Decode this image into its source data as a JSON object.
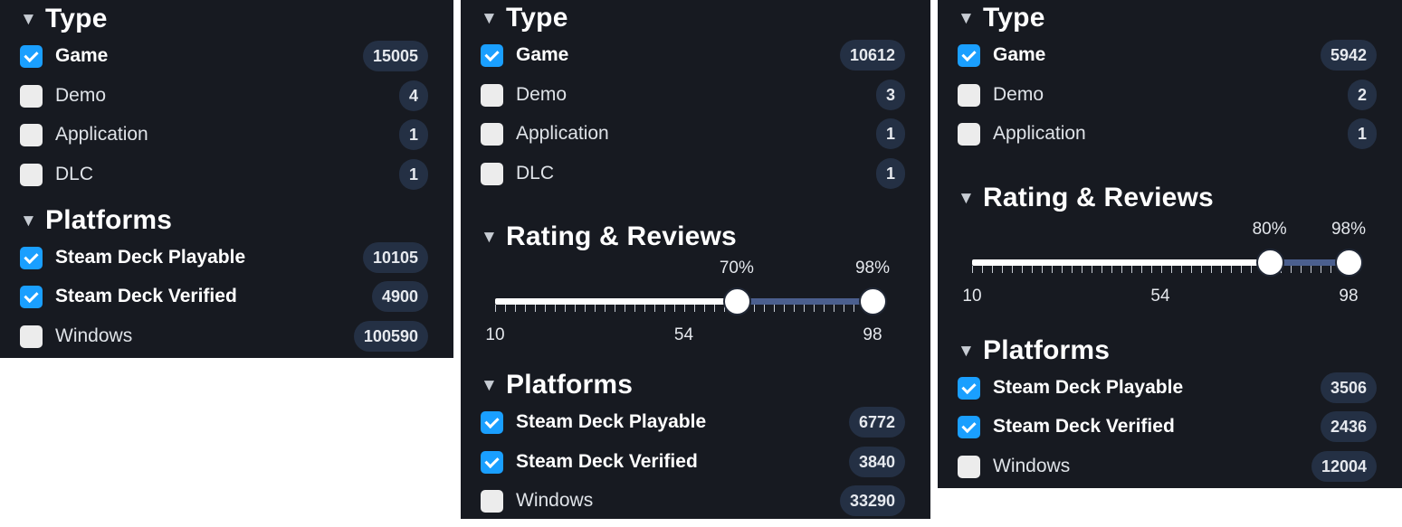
{
  "panels": [
    {
      "type": {
        "title": "Type",
        "items": [
          {
            "label": "Game",
            "count": "15005",
            "checked": true
          },
          {
            "label": "Demo",
            "count": "4",
            "checked": false
          },
          {
            "label": "Application",
            "count": "1",
            "checked": false
          },
          {
            "label": "DLC",
            "count": "1",
            "checked": false
          }
        ]
      },
      "platforms": {
        "title": "Platforms",
        "items": [
          {
            "label": "Steam Deck Playable",
            "count": "10105",
            "checked": true
          },
          {
            "label": "Steam Deck Verified",
            "count": "4900",
            "checked": true
          },
          {
            "label": "Windows",
            "count": "100590",
            "checked": false
          }
        ]
      }
    },
    {
      "type": {
        "title": "Type",
        "items": [
          {
            "label": "Game",
            "count": "10612",
            "checked": true
          },
          {
            "label": "Demo",
            "count": "3",
            "checked": false
          },
          {
            "label": "Application",
            "count": "1",
            "checked": false
          },
          {
            "label": "DLC",
            "count": "1",
            "checked": false
          }
        ]
      },
      "rating": {
        "title": "Rating & Reviews",
        "low_label": "70%",
        "high_label": "98%",
        "low_fraction": 0.64,
        "high_fraction": 1.0,
        "axis": [
          "10",
          "54",
          "98"
        ]
      },
      "platforms": {
        "title": "Platforms",
        "items": [
          {
            "label": "Steam Deck Playable",
            "count": "6772",
            "checked": true
          },
          {
            "label": "Steam Deck Verified",
            "count": "3840",
            "checked": true
          },
          {
            "label": "Windows",
            "count": "33290",
            "checked": false
          }
        ]
      }
    },
    {
      "type": {
        "title": "Type",
        "items": [
          {
            "label": "Game",
            "count": "5942",
            "checked": true
          },
          {
            "label": "Demo",
            "count": "2",
            "checked": false
          },
          {
            "label": "Application",
            "count": "1",
            "checked": false
          }
        ]
      },
      "rating": {
        "title": "Rating & Reviews",
        "low_label": "80%",
        "high_label": "98%",
        "low_fraction": 0.79,
        "high_fraction": 1.0,
        "axis": [
          "10",
          "54",
          "98"
        ]
      },
      "platforms": {
        "title": "Platforms",
        "items": [
          {
            "label": "Steam Deck Playable",
            "count": "3506",
            "checked": true
          },
          {
            "label": "Steam Deck Verified",
            "count": "2436",
            "checked": true
          },
          {
            "label": "Windows",
            "count": "12004",
            "checked": false
          }
        ]
      }
    }
  ]
}
